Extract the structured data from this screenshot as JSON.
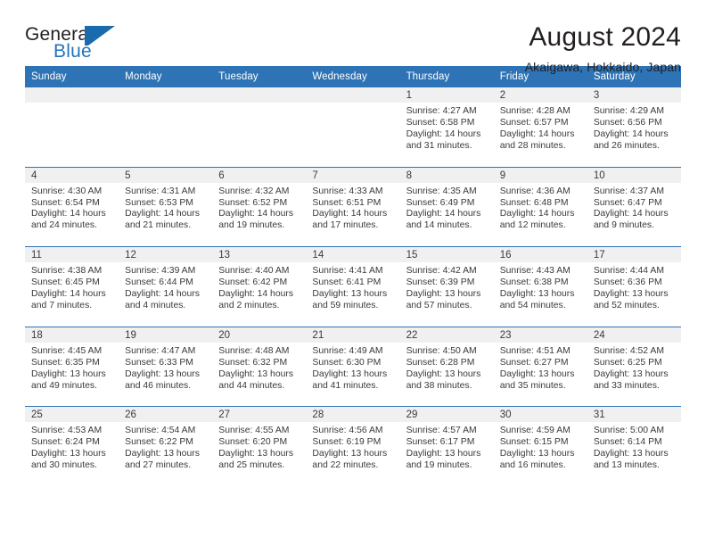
{
  "brand": {
    "name_part1": "General",
    "name_part2": "Blue",
    "flag_icon": "flag-triangle-icon"
  },
  "header": {
    "title": "August 2024",
    "location": "Akaigawa, Hokkaido, Japan"
  },
  "calendar": {
    "weekday_headers": [
      "Sunday",
      "Monday",
      "Tuesday",
      "Wednesday",
      "Thursday",
      "Friday",
      "Saturday"
    ],
    "accent_color": "#2e73b5",
    "daynum_band_color": "#f0f0f0",
    "labels": {
      "sunrise_prefix": "Sunrise:",
      "sunset_prefix": "Sunset:",
      "daylight_prefix": "Daylight:"
    },
    "weeks": [
      [
        {
          "day": "",
          "sunrise": "",
          "sunset": "",
          "daylight_line1": "",
          "daylight_line2": "",
          "empty": true
        },
        {
          "day": "",
          "sunrise": "",
          "sunset": "",
          "daylight_line1": "",
          "daylight_line2": "",
          "empty": true
        },
        {
          "day": "",
          "sunrise": "",
          "sunset": "",
          "daylight_line1": "",
          "daylight_line2": "",
          "empty": true
        },
        {
          "day": "",
          "sunrise": "",
          "sunset": "",
          "daylight_line1": "",
          "daylight_line2": "",
          "empty": true
        },
        {
          "day": "1",
          "sunrise": "Sunrise: 4:27 AM",
          "sunset": "Sunset: 6:58 PM",
          "daylight_line1": "Daylight: 14 hours",
          "daylight_line2": "and 31 minutes.",
          "empty": false
        },
        {
          "day": "2",
          "sunrise": "Sunrise: 4:28 AM",
          "sunset": "Sunset: 6:57 PM",
          "daylight_line1": "Daylight: 14 hours",
          "daylight_line2": "and 28 minutes.",
          "empty": false
        },
        {
          "day": "3",
          "sunrise": "Sunrise: 4:29 AM",
          "sunset": "Sunset: 6:56 PM",
          "daylight_line1": "Daylight: 14 hours",
          "daylight_line2": "and 26 minutes.",
          "empty": false
        }
      ],
      [
        {
          "day": "4",
          "sunrise": "Sunrise: 4:30 AM",
          "sunset": "Sunset: 6:54 PM",
          "daylight_line1": "Daylight: 14 hours",
          "daylight_line2": "and 24 minutes.",
          "empty": false
        },
        {
          "day": "5",
          "sunrise": "Sunrise: 4:31 AM",
          "sunset": "Sunset: 6:53 PM",
          "daylight_line1": "Daylight: 14 hours",
          "daylight_line2": "and 21 minutes.",
          "empty": false
        },
        {
          "day": "6",
          "sunrise": "Sunrise: 4:32 AM",
          "sunset": "Sunset: 6:52 PM",
          "daylight_line1": "Daylight: 14 hours",
          "daylight_line2": "and 19 minutes.",
          "empty": false
        },
        {
          "day": "7",
          "sunrise": "Sunrise: 4:33 AM",
          "sunset": "Sunset: 6:51 PM",
          "daylight_line1": "Daylight: 14 hours",
          "daylight_line2": "and 17 minutes.",
          "empty": false
        },
        {
          "day": "8",
          "sunrise": "Sunrise: 4:35 AM",
          "sunset": "Sunset: 6:49 PM",
          "daylight_line1": "Daylight: 14 hours",
          "daylight_line2": "and 14 minutes.",
          "empty": false
        },
        {
          "day": "9",
          "sunrise": "Sunrise: 4:36 AM",
          "sunset": "Sunset: 6:48 PM",
          "daylight_line1": "Daylight: 14 hours",
          "daylight_line2": "and 12 minutes.",
          "empty": false
        },
        {
          "day": "10",
          "sunrise": "Sunrise: 4:37 AM",
          "sunset": "Sunset: 6:47 PM",
          "daylight_line1": "Daylight: 14 hours",
          "daylight_line2": "and 9 minutes.",
          "empty": false
        }
      ],
      [
        {
          "day": "11",
          "sunrise": "Sunrise: 4:38 AM",
          "sunset": "Sunset: 6:45 PM",
          "daylight_line1": "Daylight: 14 hours",
          "daylight_line2": "and 7 minutes.",
          "empty": false
        },
        {
          "day": "12",
          "sunrise": "Sunrise: 4:39 AM",
          "sunset": "Sunset: 6:44 PM",
          "daylight_line1": "Daylight: 14 hours",
          "daylight_line2": "and 4 minutes.",
          "empty": false
        },
        {
          "day": "13",
          "sunrise": "Sunrise: 4:40 AM",
          "sunset": "Sunset: 6:42 PM",
          "daylight_line1": "Daylight: 14 hours",
          "daylight_line2": "and 2 minutes.",
          "empty": false
        },
        {
          "day": "14",
          "sunrise": "Sunrise: 4:41 AM",
          "sunset": "Sunset: 6:41 PM",
          "daylight_line1": "Daylight: 13 hours",
          "daylight_line2": "and 59 minutes.",
          "empty": false
        },
        {
          "day": "15",
          "sunrise": "Sunrise: 4:42 AM",
          "sunset": "Sunset: 6:39 PM",
          "daylight_line1": "Daylight: 13 hours",
          "daylight_line2": "and 57 minutes.",
          "empty": false
        },
        {
          "day": "16",
          "sunrise": "Sunrise: 4:43 AM",
          "sunset": "Sunset: 6:38 PM",
          "daylight_line1": "Daylight: 13 hours",
          "daylight_line2": "and 54 minutes.",
          "empty": false
        },
        {
          "day": "17",
          "sunrise": "Sunrise: 4:44 AM",
          "sunset": "Sunset: 6:36 PM",
          "daylight_line1": "Daylight: 13 hours",
          "daylight_line2": "and 52 minutes.",
          "empty": false
        }
      ],
      [
        {
          "day": "18",
          "sunrise": "Sunrise: 4:45 AM",
          "sunset": "Sunset: 6:35 PM",
          "daylight_line1": "Daylight: 13 hours",
          "daylight_line2": "and 49 minutes.",
          "empty": false
        },
        {
          "day": "19",
          "sunrise": "Sunrise: 4:47 AM",
          "sunset": "Sunset: 6:33 PM",
          "daylight_line1": "Daylight: 13 hours",
          "daylight_line2": "and 46 minutes.",
          "empty": false
        },
        {
          "day": "20",
          "sunrise": "Sunrise: 4:48 AM",
          "sunset": "Sunset: 6:32 PM",
          "daylight_line1": "Daylight: 13 hours",
          "daylight_line2": "and 44 minutes.",
          "empty": false
        },
        {
          "day": "21",
          "sunrise": "Sunrise: 4:49 AM",
          "sunset": "Sunset: 6:30 PM",
          "daylight_line1": "Daylight: 13 hours",
          "daylight_line2": "and 41 minutes.",
          "empty": false
        },
        {
          "day": "22",
          "sunrise": "Sunrise: 4:50 AM",
          "sunset": "Sunset: 6:28 PM",
          "daylight_line1": "Daylight: 13 hours",
          "daylight_line2": "and 38 minutes.",
          "empty": false
        },
        {
          "day": "23",
          "sunrise": "Sunrise: 4:51 AM",
          "sunset": "Sunset: 6:27 PM",
          "daylight_line1": "Daylight: 13 hours",
          "daylight_line2": "and 35 minutes.",
          "empty": false
        },
        {
          "day": "24",
          "sunrise": "Sunrise: 4:52 AM",
          "sunset": "Sunset: 6:25 PM",
          "daylight_line1": "Daylight: 13 hours",
          "daylight_line2": "and 33 minutes.",
          "empty": false
        }
      ],
      [
        {
          "day": "25",
          "sunrise": "Sunrise: 4:53 AM",
          "sunset": "Sunset: 6:24 PM",
          "daylight_line1": "Daylight: 13 hours",
          "daylight_line2": "and 30 minutes.",
          "empty": false
        },
        {
          "day": "26",
          "sunrise": "Sunrise: 4:54 AM",
          "sunset": "Sunset: 6:22 PM",
          "daylight_line1": "Daylight: 13 hours",
          "daylight_line2": "and 27 minutes.",
          "empty": false
        },
        {
          "day": "27",
          "sunrise": "Sunrise: 4:55 AM",
          "sunset": "Sunset: 6:20 PM",
          "daylight_line1": "Daylight: 13 hours",
          "daylight_line2": "and 25 minutes.",
          "empty": false
        },
        {
          "day": "28",
          "sunrise": "Sunrise: 4:56 AM",
          "sunset": "Sunset: 6:19 PM",
          "daylight_line1": "Daylight: 13 hours",
          "daylight_line2": "and 22 minutes.",
          "empty": false
        },
        {
          "day": "29",
          "sunrise": "Sunrise: 4:57 AM",
          "sunset": "Sunset: 6:17 PM",
          "daylight_line1": "Daylight: 13 hours",
          "daylight_line2": "and 19 minutes.",
          "empty": false
        },
        {
          "day": "30",
          "sunrise": "Sunrise: 4:59 AM",
          "sunset": "Sunset: 6:15 PM",
          "daylight_line1": "Daylight: 13 hours",
          "daylight_line2": "and 16 minutes.",
          "empty": false
        },
        {
          "day": "31",
          "sunrise": "Sunrise: 5:00 AM",
          "sunset": "Sunset: 6:14 PM",
          "daylight_line1": "Daylight: 13 hours",
          "daylight_line2": "and 13 minutes.",
          "empty": false
        }
      ]
    ]
  }
}
